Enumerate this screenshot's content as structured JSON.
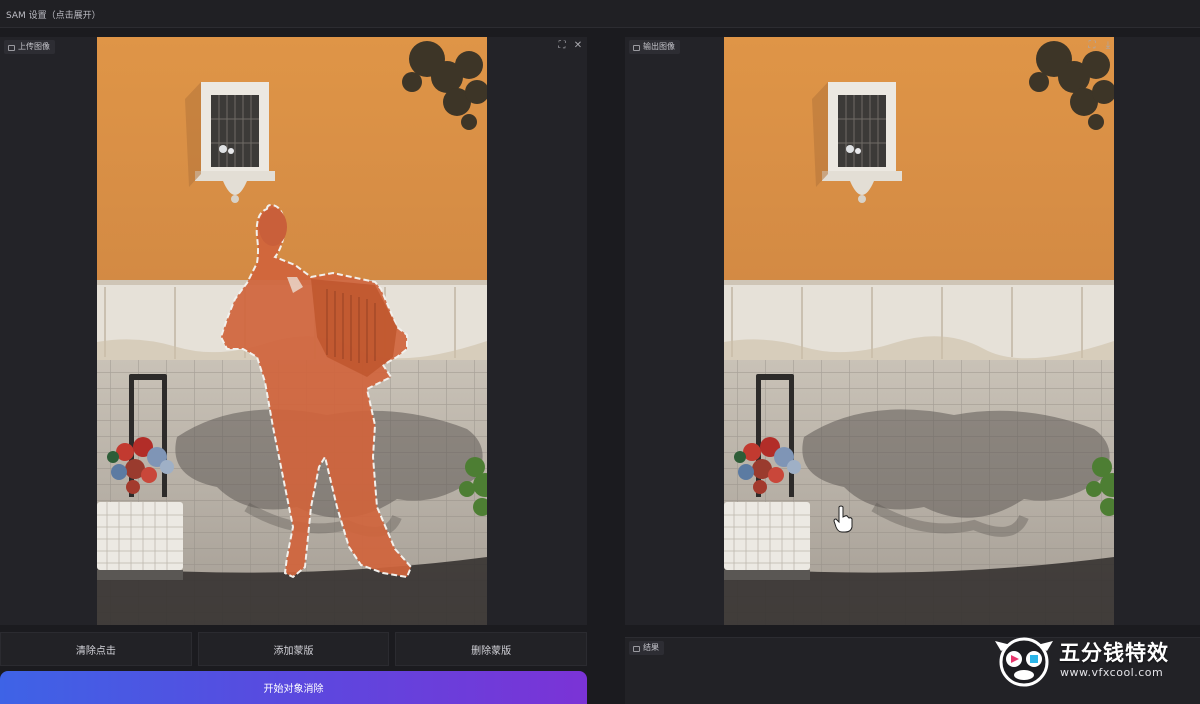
{
  "settings": {
    "title": "SAM 设置（点击展开）"
  },
  "input_panel": {
    "label": "上传图像",
    "icons": [
      "expand-icon",
      "close-icon"
    ]
  },
  "output_panel": {
    "label": "输出图像",
    "icons": [
      "expand-icon",
      "download-icon"
    ]
  },
  "buttons": {
    "clear_clicks": "清除点击",
    "add_mask": "添加蒙版",
    "delete_mask": "删除蒙版",
    "run": "开始对象消除"
  },
  "result_panel": {
    "label": "结果"
  },
  "watermark": {
    "title": "五分钱特效",
    "url": "www.vfxcool.com"
  },
  "colors": {
    "accent_start": "#3e63e6",
    "accent_end": "#7b33d6",
    "mask": "#d0643c",
    "wall": "#dc9148",
    "background": "#1b1b1f"
  }
}
